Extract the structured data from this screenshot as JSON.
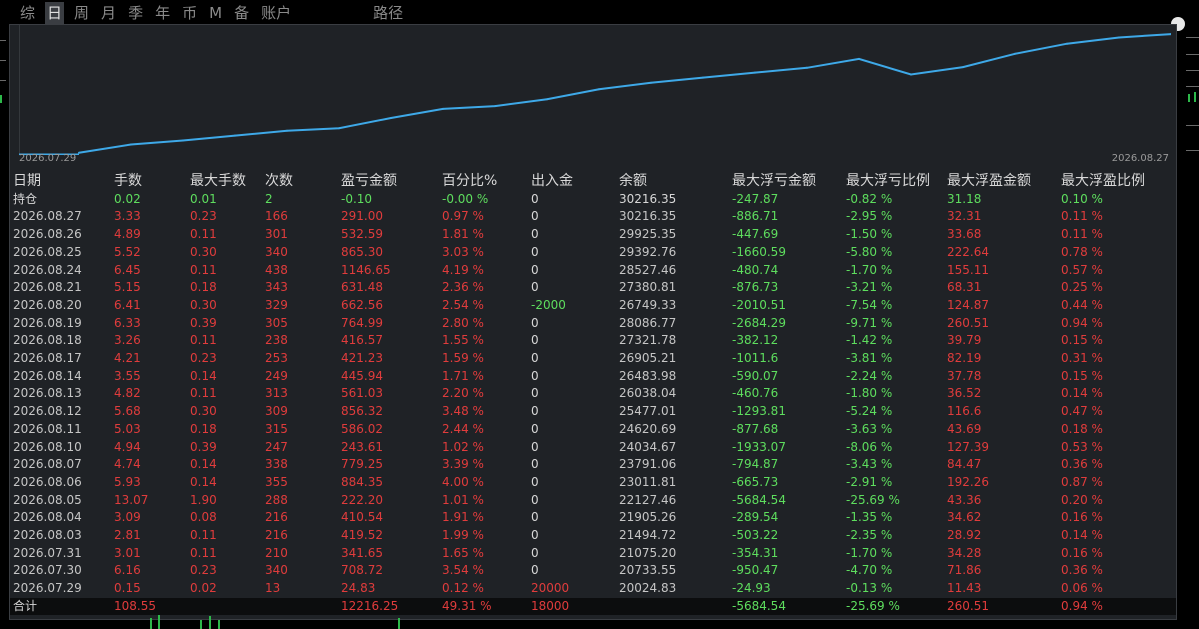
{
  "tabs": [
    {
      "label": "综",
      "active": false
    },
    {
      "label": "日",
      "active": true
    },
    {
      "label": "周",
      "active": false
    },
    {
      "label": "月",
      "active": false
    },
    {
      "label": "季",
      "active": false
    },
    {
      "label": "年",
      "active": false
    },
    {
      "label": "币",
      "active": false
    },
    {
      "label": "M",
      "active": false
    },
    {
      "label": "备",
      "active": false
    },
    {
      "label": "账户",
      "active": false
    },
    {
      "label": "路径",
      "active": false
    }
  ],
  "chart": {
    "start_label": "2026.07.29",
    "end_label": "2026.08.27",
    "line_color": "#3ea9e8"
  },
  "chart_data": {
    "type": "line",
    "x": [
      "2026.07.29",
      "2026.07.30",
      "2026.07.31",
      "2026.08.03",
      "2026.08.04",
      "2026.08.05",
      "2026.08.06",
      "2026.08.07",
      "2026.08.10",
      "2026.08.11",
      "2026.08.12",
      "2026.08.13",
      "2026.08.14",
      "2026.08.17",
      "2026.08.18",
      "2026.08.19",
      "2026.08.20",
      "2026.08.21",
      "2026.08.24",
      "2026.08.25",
      "2026.08.26",
      "2026.08.27"
    ],
    "series": [
      {
        "values": [
          20024.83,
          20733.55,
          21075.2,
          21494.72,
          21905.26,
          22127.46,
          23011.81,
          23791.06,
          24034.67,
          24620.69,
          25477.01,
          26038.04,
          26483.98,
          26905.21,
          27321.78,
          28086.77,
          26749.33,
          27380.81,
          28527.46,
          29392.76,
          29925.35,
          30216.35
        ]
      }
    ],
    "ylim": [
      20000,
      31000
    ]
  },
  "table": {
    "headers": [
      "日期",
      "手数",
      "最大手数",
      "次数",
      "盈亏金额",
      "百分比%",
      "出入金",
      "余额",
      "最大浮亏金额",
      "最大浮亏比例",
      "最大浮盈金额",
      "最大浮盈比例"
    ],
    "position_row": [
      "持仓",
      "0.02",
      "0.01",
      "2",
      "-0.10",
      "-0.00 %",
      "0",
      "30216.35",
      "-247.87",
      "-0.82 %",
      "31.18",
      "0.10 %"
    ],
    "rows": [
      [
        "2026.08.27",
        "3.33",
        "0.23",
        "166",
        "291.00",
        "0.97 %",
        "0",
        "30216.35",
        "-886.71",
        "-2.95 %",
        "32.31",
        "0.11 %"
      ],
      [
        "2026.08.26",
        "4.89",
        "0.11",
        "301",
        "532.59",
        "1.81 %",
        "0",
        "29925.35",
        "-447.69",
        "-1.50 %",
        "33.68",
        "0.11 %"
      ],
      [
        "2026.08.25",
        "5.52",
        "0.30",
        "340",
        "865.30",
        "3.03 %",
        "0",
        "29392.76",
        "-1660.59",
        "-5.80 %",
        "222.64",
        "0.78 %"
      ],
      [
        "2026.08.24",
        "6.45",
        "0.11",
        "438",
        "1146.65",
        "4.19 %",
        "0",
        "28527.46",
        "-480.74",
        "-1.70 %",
        "155.11",
        "0.57 %"
      ],
      [
        "2026.08.21",
        "5.15",
        "0.18",
        "343",
        "631.48",
        "2.36 %",
        "0",
        "27380.81",
        "-876.73",
        "-3.21 %",
        "68.31",
        "0.25 %"
      ],
      [
        "2026.08.20",
        "6.41",
        "0.30",
        "329",
        "662.56",
        "2.54 %",
        "-2000",
        "26749.33",
        "-2010.51",
        "-7.54 %",
        "124.87",
        "0.44 %"
      ],
      [
        "2026.08.19",
        "6.33",
        "0.39",
        "305",
        "764.99",
        "2.80 %",
        "0",
        "28086.77",
        "-2684.29",
        "-9.71 %",
        "260.51",
        "0.94 %"
      ],
      [
        "2026.08.18",
        "3.26",
        "0.11",
        "238",
        "416.57",
        "1.55 %",
        "0",
        "27321.78",
        "-382.12",
        "-1.42 %",
        "39.79",
        "0.15 %"
      ],
      [
        "2026.08.17",
        "4.21",
        "0.23",
        "253",
        "421.23",
        "1.59 %",
        "0",
        "26905.21",
        "-1011.6",
        "-3.81 %",
        "82.19",
        "0.31 %"
      ],
      [
        "2026.08.14",
        "3.55",
        "0.14",
        "249",
        "445.94",
        "1.71 %",
        "0",
        "26483.98",
        "-590.07",
        "-2.24 %",
        "37.78",
        "0.15 %"
      ],
      [
        "2026.08.13",
        "4.82",
        "0.11",
        "313",
        "561.03",
        "2.20 %",
        "0",
        "26038.04",
        "-460.76",
        "-1.80 %",
        "36.52",
        "0.14 %"
      ],
      [
        "2026.08.12",
        "5.68",
        "0.30",
        "309",
        "856.32",
        "3.48 %",
        "0",
        "25477.01",
        "-1293.81",
        "-5.24 %",
        "116.6",
        "0.47 %"
      ],
      [
        "2026.08.11",
        "5.03",
        "0.18",
        "315",
        "586.02",
        "2.44 %",
        "0",
        "24620.69",
        "-877.68",
        "-3.63 %",
        "43.69",
        "0.18 %"
      ],
      [
        "2026.08.10",
        "4.94",
        "0.39",
        "247",
        "243.61",
        "1.02 %",
        "0",
        "24034.67",
        "-1933.07",
        "-8.06 %",
        "127.39",
        "0.53 %"
      ],
      [
        "2026.08.07",
        "4.74",
        "0.14",
        "338",
        "779.25",
        "3.39 %",
        "0",
        "23791.06",
        "-794.87",
        "-3.43 %",
        "84.47",
        "0.36 %"
      ],
      [
        "2026.08.06",
        "5.93",
        "0.14",
        "355",
        "884.35",
        "4.00 %",
        "0",
        "23011.81",
        "-665.73",
        "-2.91 %",
        "192.26",
        "0.87 %"
      ],
      [
        "2026.08.05",
        "13.07",
        "1.90",
        "288",
        "222.20",
        "1.01 %",
        "0",
        "22127.46",
        "-5684.54",
        "-25.69 %",
        "43.36",
        "0.20 %"
      ],
      [
        "2026.08.04",
        "3.09",
        "0.08",
        "216",
        "410.54",
        "1.91 %",
        "0",
        "21905.26",
        "-289.54",
        "-1.35 %",
        "34.62",
        "0.16 %"
      ],
      [
        "2026.08.03",
        "2.81",
        "0.11",
        "216",
        "419.52",
        "1.99 %",
        "0",
        "21494.72",
        "-503.22",
        "-2.35 %",
        "28.92",
        "0.14 %"
      ],
      [
        "2026.07.31",
        "3.01",
        "0.11",
        "210",
        "341.65",
        "1.65 %",
        "0",
        "21075.20",
        "-354.31",
        "-1.70 %",
        "34.28",
        "0.16 %"
      ],
      [
        "2026.07.30",
        "6.16",
        "0.23",
        "340",
        "708.72",
        "3.54 %",
        "0",
        "20733.55",
        "-950.47",
        "-4.70 %",
        "71.86",
        "0.36 %"
      ],
      [
        "2026.07.29",
        "0.15",
        "0.02",
        "13",
        "24.83",
        "0.12 %",
        "20000",
        "20024.83",
        "-24.93",
        "-0.13 %",
        "11.43",
        "0.06 %"
      ]
    ],
    "total_row": [
      "合计",
      "108.55",
      "",
      "",
      "12216.25",
      "49.31 %",
      "18000",
      "",
      "-5684.54",
      "-25.69 %",
      "260.51",
      "0.94 %"
    ]
  },
  "colors": {
    "positive": "#e03c3c",
    "negative": "#5ede5e",
    "panel_bg": "#1f2226"
  }
}
